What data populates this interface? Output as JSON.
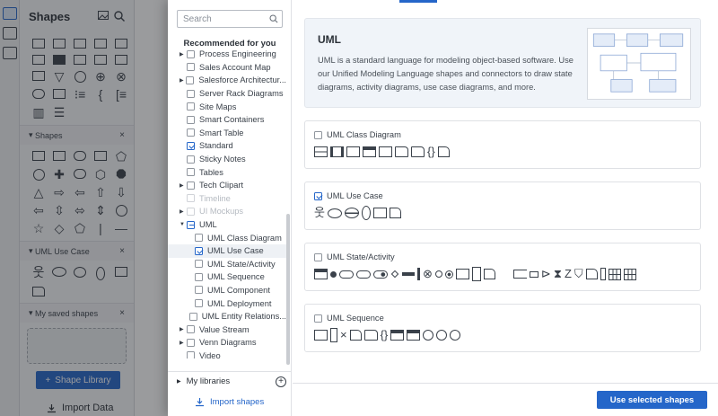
{
  "app": {
    "panel_title": "Shapes",
    "sections": [
      {
        "title": "Shapes"
      },
      {
        "title": "UML Use Case"
      },
      {
        "title": "My saved shapes"
      }
    ],
    "shape_library_button": "Shape Library",
    "import_data": "Import Data"
  },
  "modal": {
    "search": {
      "placeholder": "Search",
      "value": ""
    },
    "recommended_title": "Recommended for you",
    "library_list": [
      {
        "label": "Process Engineering",
        "checked": false,
        "expandable": true,
        "level": 0,
        "state": "normal"
      },
      {
        "label": "Sales Account Map",
        "checked": false,
        "expandable": false,
        "level": 0,
        "state": "normal"
      },
      {
        "label": "Salesforce Architectur...",
        "checked": false,
        "expandable": true,
        "level": 0,
        "state": "normal"
      },
      {
        "label": "Server Rack Diagrams",
        "checked": false,
        "expandable": false,
        "level": 0,
        "state": "normal"
      },
      {
        "label": "Site Maps",
        "checked": false,
        "expandable": false,
        "level": 0,
        "state": "normal"
      },
      {
        "label": "Smart Containers",
        "checked": false,
        "expandable": false,
        "level": 0,
        "state": "normal"
      },
      {
        "label": "Smart Table",
        "checked": false,
        "expandable": false,
        "level": 0,
        "state": "normal"
      },
      {
        "label": "Standard",
        "checked": true,
        "expandable": false,
        "level": 0,
        "state": "normal"
      },
      {
        "label": "Sticky Notes",
        "checked": false,
        "expandable": false,
        "level": 0,
        "state": "normal"
      },
      {
        "label": "Tables",
        "checked": false,
        "expandable": false,
        "level": 0,
        "state": "normal"
      },
      {
        "label": "Tech Clipart",
        "checked": false,
        "expandable": true,
        "level": 0,
        "state": "normal"
      },
      {
        "label": "Timeline",
        "checked": false,
        "expandable": false,
        "level": 0,
        "state": "disabled"
      },
      {
        "label": "UI Mockups",
        "checked": false,
        "expandable": true,
        "level": 0,
        "state": "disabled"
      },
      {
        "label": "UML",
        "checked": "partial",
        "expandable": true,
        "level": 0,
        "state": "expanded"
      },
      {
        "label": "UML Class Diagram",
        "checked": false,
        "expandable": false,
        "level": 1,
        "state": "normal"
      },
      {
        "label": "UML Use Case",
        "checked": true,
        "expandable": false,
        "level": 1,
        "state": "highlight"
      },
      {
        "label": "UML State/Activity",
        "checked": false,
        "expandable": false,
        "level": 1,
        "state": "normal"
      },
      {
        "label": "UML Sequence",
        "checked": false,
        "expandable": false,
        "level": 1,
        "state": "normal"
      },
      {
        "label": "UML Component",
        "checked": false,
        "expandable": false,
        "level": 1,
        "state": "normal"
      },
      {
        "label": "UML Deployment",
        "checked": false,
        "expandable": false,
        "level": 1,
        "state": "normal"
      },
      {
        "label": "UML Entity Relations...",
        "checked": false,
        "expandable": false,
        "level": 1,
        "state": "normal"
      },
      {
        "label": "Value Stream",
        "checked": false,
        "expandable": true,
        "level": 0,
        "state": "normal"
      },
      {
        "label": "Venn Diagrams",
        "checked": false,
        "expandable": true,
        "level": 0,
        "state": "normal"
      },
      {
        "label": "Video",
        "checked": false,
        "expandable": false,
        "level": 0,
        "state": "normal"
      }
    ],
    "my_libraries": "My libraries",
    "import_shapes": "Import shapes",
    "hero": {
      "title": "UML",
      "description": "UML is a standard language for modeling object-based software. Use our Unified Modeling Language shapes and connectors to draw state diagrams, activity diagrams, use case diagrams, and more."
    },
    "cards": [
      {
        "title": "UML Class Diagram",
        "checked": false
      },
      {
        "title": "UML Use Case",
        "checked": true
      },
      {
        "title": "UML State/Activity",
        "checked": false
      },
      {
        "title": "UML Sequence",
        "checked": false
      }
    ],
    "use_button": "Use selected shapes"
  },
  "colors": {
    "accent": "#2566c9",
    "text": "#3a414a",
    "hero_bg": "#f0f4f9"
  }
}
